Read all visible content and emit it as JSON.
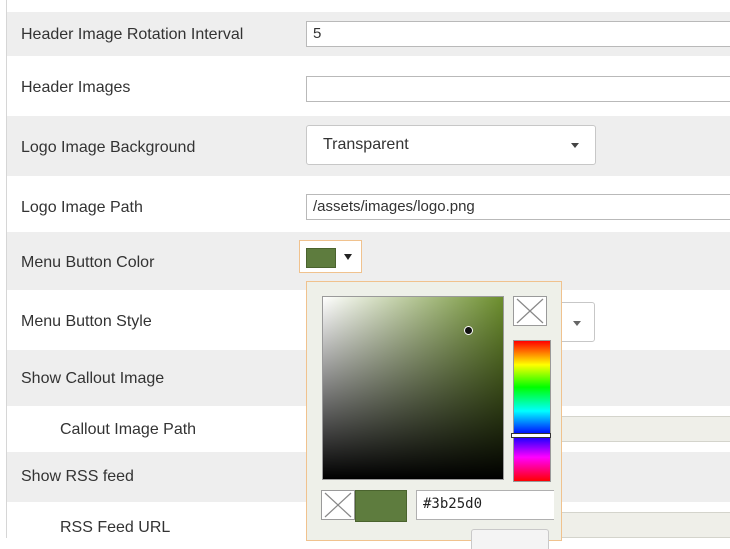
{
  "settings": {
    "header_rotation": {
      "label": "Header Image Rotation Interval",
      "value": "5"
    },
    "header_images": {
      "label": "Header Images",
      "value": ""
    },
    "logo_bg": {
      "label": "Logo Image Background",
      "value": "Transparent"
    },
    "logo_path": {
      "label": "Logo Image Path",
      "value": "/assets/images/logo.png"
    },
    "menu_color": {
      "label": "Menu Button Color",
      "color": "#5e7c3e"
    },
    "menu_style": {
      "label": "Menu Button Style"
    },
    "show_callout": {
      "label": "Show Callout Image"
    },
    "callout_path": {
      "label": "Callout Image Path",
      "value": ""
    },
    "show_rss": {
      "label": "Show RSS feed"
    },
    "rss_url": {
      "label": "RSS Feed URL",
      "value": ""
    }
  },
  "color_picker": {
    "hex_value": "#3b25d0",
    "selected_color": "#5e7c3e",
    "hue_color": "#6d8f2e"
  }
}
